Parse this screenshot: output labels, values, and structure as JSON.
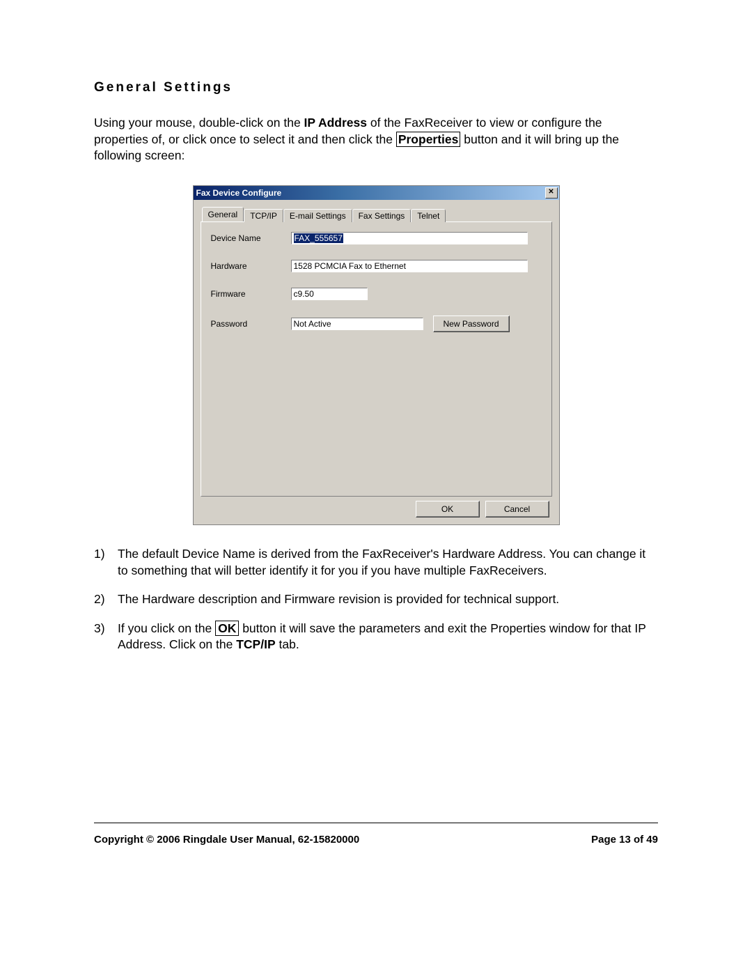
{
  "heading": "General Settings",
  "intro": {
    "part1": "Using your mouse, double-click on the ",
    "bold1": "IP Address",
    "part2": " of the FaxReceiver to view or configure the properties of, or click once to select it and then click the ",
    "boxed": "Properties",
    "part3": " button and it will bring up the following screen:"
  },
  "dialog": {
    "title": "Fax Device Configure",
    "close_glyph": "✕",
    "tabs": [
      "General",
      "TCP/IP",
      "E-mail Settings",
      "Fax Settings",
      "Telnet"
    ],
    "fields": {
      "device_name_label": "Device Name",
      "device_name_value": "FAX_555657",
      "hardware_label": "Hardware",
      "hardware_value": "1528 PCMCIA Fax to Ethernet",
      "firmware_label": "Firmware",
      "firmware_value": "c9.50",
      "password_label": "Password",
      "password_value": "Not Active",
      "new_password_btn": "New Password"
    },
    "ok": "OK",
    "cancel": "Cancel"
  },
  "list": {
    "i1_num": "1)",
    "i1": "The default Device Name is derived from the FaxReceiver's Hardware Address. You can change it to something that will better identify it for you if you have multiple FaxReceivers.",
    "i2_num": "2)",
    "i2": "The Hardware description and Firmware revision is provided for technical support.",
    "i3_num": "3)",
    "i3_a": "If you click on the ",
    "i3_box": "OK",
    "i3_b": " button it will save the parameters and exit the Properties window for that IP Address. Click on the ",
    "i3_bold": "TCP/IP",
    "i3_c": " tab."
  },
  "footer": {
    "left": "Copyright © 2006 Ringdale   User Manual, 62-15820000",
    "right": "Page 13 of 49"
  }
}
